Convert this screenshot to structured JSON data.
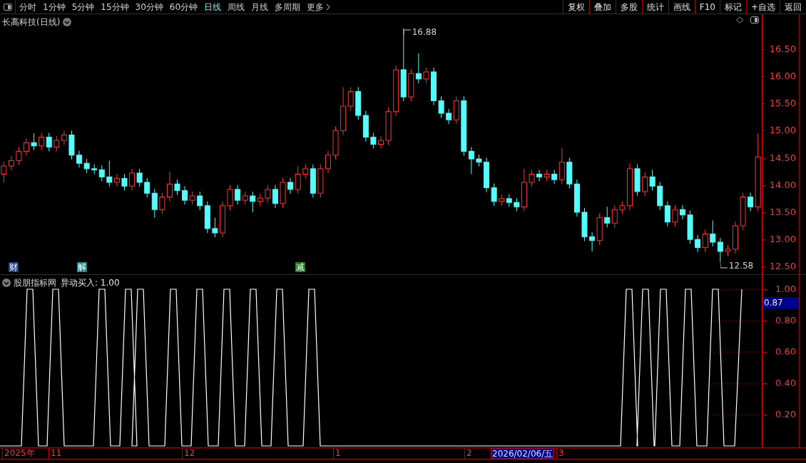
{
  "toolbar": {
    "periods": [
      {
        "label": "分时",
        "selected": false
      },
      {
        "label": "1分钟",
        "selected": false
      },
      {
        "label": "5分钟",
        "selected": false
      },
      {
        "label": "15分钟",
        "selected": false
      },
      {
        "label": "30分钟",
        "selected": false
      },
      {
        "label": "60分钟",
        "selected": false
      },
      {
        "label": "日线",
        "selected": true
      },
      {
        "label": "周线",
        "selected": false
      },
      {
        "label": "月线",
        "selected": false
      },
      {
        "label": "多周期",
        "selected": false
      }
    ],
    "more": "更多",
    "actions": [
      "复权",
      "叠加",
      "多股",
      "统计",
      "画线",
      "F10",
      "标记",
      "+自选",
      "返回"
    ]
  },
  "price_chart": {
    "title": "长高科技(日线)",
    "high_marker": "16.88",
    "low_marker": "12.58",
    "chart_data": {
      "type": "candlestick",
      "ylim": [
        12.36,
        17.14
      ],
      "yticks": [
        {
          "value": 16.5,
          "label": "16.50"
        },
        {
          "value": 16,
          "label": "16.00"
        },
        {
          "value": 15.5,
          "label": "15.50"
        },
        {
          "value": 15,
          "label": "15.00"
        },
        {
          "value": 14.5,
          "label": "14.50"
        },
        {
          "value": 14,
          "label": "14.00"
        },
        {
          "value": 13.5,
          "label": "13.50"
        },
        {
          "value": 13,
          "label": "13.00"
        },
        {
          "value": 12.5,
          "label": "12.50"
        }
      ],
      "ohlc": [
        [
          14.2,
          14.43,
          14.05,
          14.35
        ],
        [
          14.35,
          14.53,
          14.27,
          14.45
        ],
        [
          14.45,
          14.7,
          14.37,
          14.62
        ],
        [
          14.62,
          14.86,
          14.54,
          14.78
        ],
        [
          14.78,
          14.95,
          14.64,
          14.72
        ],
        [
          14.72,
          14.96,
          14.64,
          14.88
        ],
        [
          14.88,
          14.96,
          14.62,
          14.7
        ],
        [
          14.7,
          14.9,
          14.62,
          14.82
        ],
        [
          14.82,
          15.0,
          14.74,
          14.92
        ],
        [
          14.92,
          15.0,
          14.47,
          14.55
        ],
        [
          14.55,
          14.63,
          14.32,
          14.4
        ],
        [
          14.4,
          14.48,
          14.22,
          14.3
        ],
        [
          14.3,
          14.38,
          14.2,
          14.28
        ],
        [
          14.28,
          14.36,
          14.07,
          14.15
        ],
        [
          14.15,
          14.45,
          13.97,
          14.05
        ],
        [
          14.05,
          14.2,
          13.97,
          14.12
        ],
        [
          14.12,
          14.2,
          13.9,
          13.98
        ],
        [
          13.98,
          14.3,
          13.9,
          14.22
        ],
        [
          14.22,
          14.3,
          13.97,
          14.05
        ],
        [
          14.05,
          14.13,
          13.77,
          13.85
        ],
        [
          13.85,
          13.93,
          13.4,
          13.55
        ],
        [
          13.55,
          13.86,
          13.47,
          13.78
        ],
        [
          13.78,
          14.25,
          13.7,
          14.02
        ],
        [
          14.02,
          14.1,
          13.82,
          13.9
        ],
        [
          13.9,
          13.98,
          13.64,
          13.72
        ],
        [
          13.72,
          13.88,
          13.64,
          13.8
        ],
        [
          13.8,
          13.88,
          13.54,
          13.62
        ],
        [
          13.62,
          13.7,
          13.12,
          13.2
        ],
        [
          13.2,
          13.4,
          13.04,
          13.12
        ],
        [
          13.12,
          13.7,
          13.04,
          13.62
        ],
        [
          13.62,
          14.0,
          13.54,
          13.92
        ],
        [
          13.92,
          14.0,
          13.64,
          13.72
        ],
        [
          13.72,
          13.88,
          13.64,
          13.8
        ],
        [
          13.8,
          13.88,
          13.5,
          13.7
        ],
        [
          13.7,
          13.84,
          13.62,
          13.76
        ],
        [
          13.76,
          14.0,
          13.68,
          13.92
        ],
        [
          13.92,
          14.0,
          13.58,
          13.66
        ],
        [
          13.66,
          14.13,
          13.58,
          14.05
        ],
        [
          14.05,
          14.13,
          13.84,
          13.92
        ],
        [
          13.92,
          14.35,
          13.84,
          14.2
        ],
        [
          14.2,
          14.38,
          14.12,
          14.3
        ],
        [
          14.3,
          14.38,
          13.77,
          13.85
        ],
        [
          13.85,
          14.38,
          13.77,
          14.3
        ],
        [
          14.3,
          14.63,
          14.22,
          14.55
        ],
        [
          14.55,
          15.08,
          14.47,
          15.0
        ],
        [
          15.0,
          15.8,
          14.92,
          15.45
        ],
        [
          15.45,
          15.8,
          15.37,
          15.72
        ],
        [
          15.72,
          15.8,
          15.2,
          15.28
        ],
        [
          15.28,
          15.36,
          14.8,
          14.88
        ],
        [
          14.88,
          14.96,
          14.67,
          14.75
        ],
        [
          14.75,
          14.9,
          14.67,
          14.82
        ],
        [
          14.82,
          15.43,
          14.74,
          15.35
        ],
        [
          15.35,
          16.2,
          15.27,
          16.12
        ],
        [
          16.12,
          16.88,
          15.54,
          15.62
        ],
        [
          15.62,
          16.13,
          15.54,
          16.05
        ],
        [
          16.05,
          16.42,
          15.87,
          15.95
        ],
        [
          15.95,
          16.16,
          15.87,
          16.08
        ],
        [
          16.08,
          16.16,
          15.47,
          15.55
        ],
        [
          15.55,
          15.63,
          15.24,
          15.32
        ],
        [
          15.32,
          15.4,
          15.12,
          15.2
        ],
        [
          15.2,
          15.63,
          15.12,
          15.55
        ],
        [
          15.55,
          15.63,
          14.54,
          14.62
        ],
        [
          14.62,
          14.7,
          14.2,
          14.48
        ],
        [
          14.48,
          14.56,
          14.34,
          14.42
        ],
        [
          14.42,
          14.5,
          13.87,
          13.95
        ],
        [
          13.95,
          14.03,
          13.62,
          13.7
        ],
        [
          13.7,
          13.83,
          13.62,
          13.75
        ],
        [
          13.75,
          13.83,
          13.6,
          13.68
        ],
        [
          13.68,
          13.76,
          13.52,
          13.6
        ],
        [
          13.6,
          14.3,
          13.52,
          14.05
        ],
        [
          14.05,
          14.28,
          13.97,
          14.2
        ],
        [
          14.2,
          14.28,
          14.07,
          14.15
        ],
        [
          14.15,
          14.28,
          14.07,
          14.2
        ],
        [
          14.2,
          14.28,
          14.02,
          14.1
        ],
        [
          14.1,
          14.68,
          14.02,
          14.42
        ],
        [
          14.42,
          14.5,
          13.94,
          14.02
        ],
        [
          14.02,
          14.1,
          13.42,
          13.5
        ],
        [
          13.5,
          13.58,
          12.97,
          13.05
        ],
        [
          13.05,
          13.13,
          12.78,
          12.98
        ],
        [
          12.98,
          13.48,
          12.9,
          13.4
        ],
        [
          13.4,
          13.6,
          13.22,
          13.3
        ],
        [
          13.3,
          13.63,
          13.22,
          13.55
        ],
        [
          13.55,
          13.7,
          13.47,
          13.62
        ],
        [
          13.62,
          14.4,
          13.54,
          14.3
        ],
        [
          14.3,
          14.38,
          13.8,
          13.88
        ],
        [
          13.88,
          14.23,
          13.8,
          14.15
        ],
        [
          14.15,
          14.28,
          13.9,
          13.98
        ],
        [
          13.98,
          14.06,
          13.54,
          13.62
        ],
        [
          13.62,
          13.7,
          13.24,
          13.32
        ],
        [
          13.32,
          13.63,
          13.24,
          13.55
        ],
        [
          13.55,
          13.63,
          13.37,
          13.45
        ],
        [
          13.45,
          13.53,
          12.92,
          13.0
        ],
        [
          13.0,
          13.08,
          12.77,
          12.85
        ],
        [
          12.85,
          13.18,
          12.77,
          13.1
        ],
        [
          13.1,
          13.35,
          12.87,
          12.95
        ],
        [
          12.95,
          13.03,
          12.58,
          12.78
        ],
        [
          12.78,
          12.9,
          12.7,
          12.82
        ],
        [
          12.82,
          13.33,
          12.74,
          13.25
        ],
        [
          13.25,
          13.86,
          13.17,
          13.78
        ],
        [
          13.78,
          13.86,
          13.52,
          13.6
        ],
        [
          13.6,
          14.95,
          13.52,
          14.52
        ]
      ]
    },
    "event_tags": [
      {
        "label": "财",
        "color": "#1c3f8c"
      },
      {
        "label": "解",
        "color": "#0e8a8a"
      },
      {
        "label": "减",
        "color": "#1f7a1f"
      }
    ]
  },
  "indicator": {
    "name": "股朋指标网",
    "readout": "异动买入: 1.00",
    "y_labels": [
      "1.00",
      "0.80",
      "0.60",
      "0.40",
      "0.20"
    ],
    "cursor_value": "0.87"
  },
  "time_axis": {
    "labels": [
      {
        "label": "2025年",
        "selected": false
      },
      {
        "label": "11",
        "selected": false
      },
      {
        "label": "12",
        "selected": false
      },
      {
        "label": "1",
        "selected": false
      },
      {
        "label": "2",
        "selected": false
      },
      {
        "label": "2026/02/06/五",
        "selected": true
      },
      {
        "label": "3",
        "selected": false
      }
    ]
  }
}
